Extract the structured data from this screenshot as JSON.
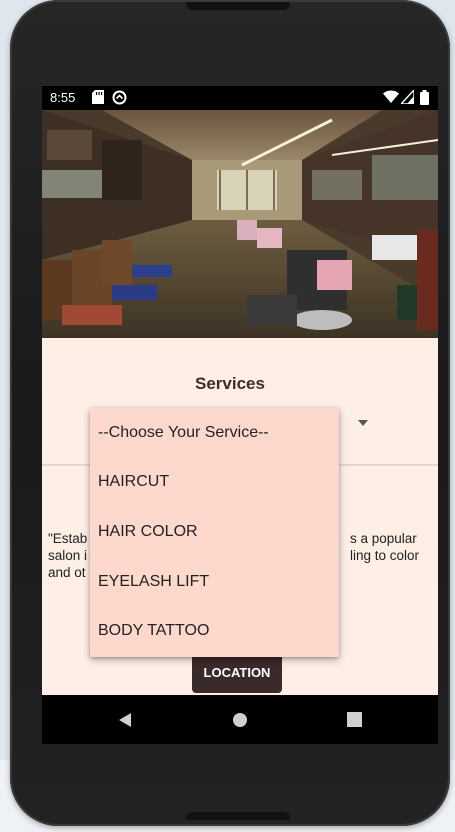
{
  "status_bar": {
    "time": "8:55",
    "icons": [
      "sd-card-icon",
      "sync-icon",
      "wifi-icon",
      "signal-icon",
      "battery-icon"
    ]
  },
  "hero_image": {
    "subject": "barbershop-interior"
  },
  "services": {
    "title": "Services",
    "dropdown_options": [
      "--Choose Your Service--",
      "HAIRCUT",
      "HAIR COLOR",
      "EYELASH LIFT",
      "BODY TATTOO"
    ]
  },
  "about": {
    "line1_left": "\"Estab",
    "line1_right": "s a popular",
    "line2_left": "salon i",
    "line2_right": "ling to color",
    "line3_left": "and ot"
  },
  "location_button": {
    "label": "LOCATION"
  },
  "nav": {
    "back": "back-icon",
    "home": "home-icon",
    "recents": "recents-icon"
  },
  "colors": {
    "content_bg": "#fdeee6",
    "dropdown_bg": "#fdd8cc",
    "button_bg": "#3b2a2a",
    "title_color": "#3b2e2a"
  }
}
